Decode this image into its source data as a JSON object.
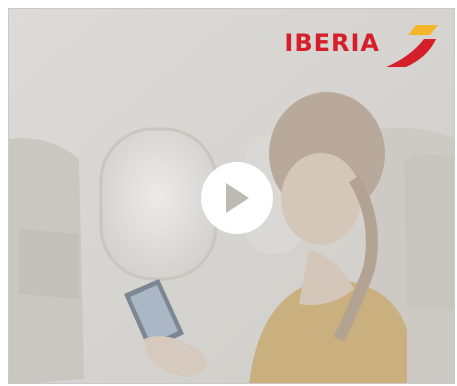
{
  "brand": {
    "name": "IBERIA",
    "red": "#d51f2a",
    "yellow": "#f5b52a"
  },
  "player": {
    "play_icon": "play-icon"
  }
}
